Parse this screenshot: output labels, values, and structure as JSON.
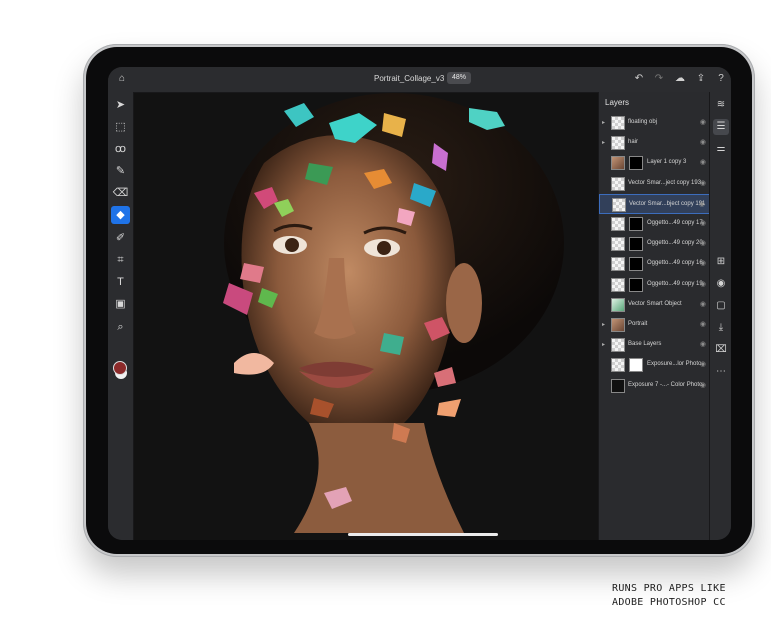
{
  "topbar": {
    "title": "Portrait_Collage_v3",
    "zoom": "48%",
    "icons": [
      "home-icon",
      "undo-icon",
      "redo-icon",
      "cloud-icon",
      "share-icon",
      "help-icon"
    ]
  },
  "toolbar": {
    "tools": [
      {
        "name": "move-tool",
        "glyph": "➤"
      },
      {
        "name": "transform-tool",
        "glyph": "⬚"
      },
      {
        "name": "lasso-tool",
        "glyph": "ꝏ"
      },
      {
        "name": "brush-tool",
        "glyph": "✎"
      },
      {
        "name": "eraser-tool",
        "glyph": "⌫"
      },
      {
        "name": "fill-tool",
        "glyph": "◆"
      },
      {
        "name": "clone-tool",
        "glyph": "✐"
      },
      {
        "name": "crop-tool",
        "glyph": "⌗"
      },
      {
        "name": "type-tool",
        "glyph": "T"
      },
      {
        "name": "image-tool",
        "glyph": "▣"
      },
      {
        "name": "eyedropper-tool",
        "glyph": "⌕"
      }
    ],
    "active_tool": "fill-tool",
    "foreground_color": "#8c2a2a",
    "background_color": "#f2f2f2"
  },
  "layers": {
    "title": "Layers",
    "items": [
      {
        "label": "floating obj",
        "thumb": "checker",
        "mask": "",
        "expandable": true,
        "selected": false
      },
      {
        "label": "hair",
        "thumb": "checker",
        "mask": "",
        "expandable": true,
        "selected": false
      },
      {
        "label": "Layer 1 copy 3",
        "thumb": "photo",
        "mask": "black",
        "expandable": false,
        "selected": false
      },
      {
        "label": "Vector Smar...ject copy 193",
        "thumb": "checker",
        "mask": "",
        "expandable": false,
        "selected": false
      },
      {
        "label": "Vector Smar...bject copy 191",
        "thumb": "checker",
        "mask": "",
        "expandable": false,
        "selected": true
      },
      {
        "label": "Oggetto...49 copy 17",
        "thumb": "checker",
        "mask": "black",
        "expandable": false,
        "selected": false
      },
      {
        "label": "Oggetto...49 copy 20",
        "thumb": "checker",
        "mask": "black",
        "expandable": false,
        "selected": false
      },
      {
        "label": "Oggetto...49 copy 16",
        "thumb": "checker",
        "mask": "black",
        "expandable": false,
        "selected": false
      },
      {
        "label": "Oggetto...49 copy 19",
        "thumb": "checker",
        "mask": "black",
        "expandable": false,
        "selected": false
      },
      {
        "label": "Vector Smart Object",
        "thumb": "green",
        "mask": "",
        "expandable": false,
        "selected": false
      },
      {
        "label": "Portrait",
        "thumb": "photo",
        "mask": "",
        "expandable": true,
        "selected": false
      },
      {
        "label": "Base Layers",
        "thumb": "checker",
        "mask": "",
        "expandable": true,
        "selected": false
      },
      {
        "label": "Exposure...lor Photo",
        "thumb": "checker",
        "mask": "white",
        "expandable": false,
        "selected": false
      },
      {
        "label": "Exposure 7 -...- Color Photo",
        "thumb": "dark",
        "mask": "",
        "expandable": false,
        "selected": false
      }
    ]
  },
  "rail": {
    "icons": [
      "layers-icon",
      "layer-properties-icon",
      "adjustments-icon",
      "add-layer-icon",
      "visibility-icon",
      "mask-icon",
      "clip-icon",
      "erase-layer-icon",
      "more-icon"
    ]
  },
  "caption": {
    "line1": "RUNS PRO APPS LIKE",
    "line2": "ADOBE PHOTOSHOP CC"
  }
}
